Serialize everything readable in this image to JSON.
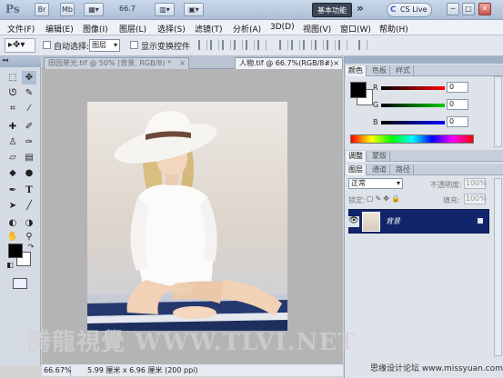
{
  "appbar": {
    "logo": "Ps",
    "br": "Br",
    "mb": "Mb",
    "zoom": "66.7",
    "workspace": "基本功能",
    "cslive": "CS Live",
    "win_minimize": "─",
    "win_restore": "□",
    "win_close": "✕"
  },
  "menu": [
    "文件(F)",
    "编辑(E)",
    "图像(I)",
    "图层(L)",
    "选择(S)",
    "滤镜(T)",
    "分析(A)",
    "3D(D)",
    "视图(V)",
    "窗口(W)",
    "帮助(H)"
  ],
  "options": {
    "auto_select": "自动选择:",
    "auto_select_value": "图层",
    "show_transform": "显示变换控件"
  },
  "tabs": {
    "inactive": "田园景光.tif @ 50% (背景, RGB/8) *",
    "active": "人物.tif @ 66.7%(RGB/8#)",
    "close": "×"
  },
  "status": {
    "zoom": "66.67%",
    "info": "5.99 厘米 x 6.96 厘米 (200 ppi)"
  },
  "color_panel": {
    "tabs": [
      "颜色",
      "色板",
      "样式"
    ],
    "r_label": "R",
    "g_label": "G",
    "b_label": "B",
    "r": "0",
    "g": "0",
    "b": "0"
  },
  "adjust_panel": {
    "tabs": [
      "调整",
      "蒙版"
    ]
  },
  "layers_panel": {
    "tabs": [
      "图层",
      "通道",
      "路径"
    ],
    "blend_mode": "正常",
    "opacity_label": "不透明度:",
    "opacity": "100%",
    "lock_label": "锁定:",
    "fill_label": "填充:",
    "fill": "100%",
    "layer_name": "背景"
  },
  "watermark": "腾龍視覺 WWW.TLVI.NET",
  "credit": "思缘设计论坛 www.missyuan.com"
}
